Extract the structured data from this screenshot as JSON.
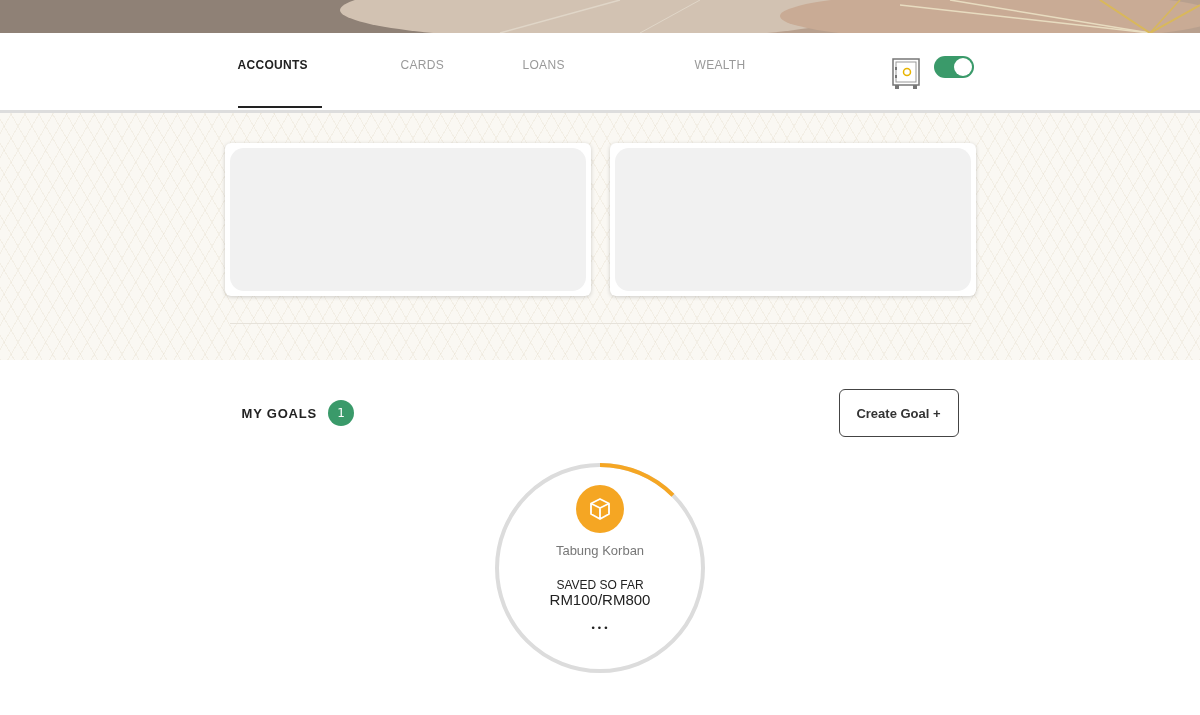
{
  "tabs": [
    {
      "label": "ACCOUNTS",
      "selected": true
    },
    {
      "label": "CARDS",
      "selected": false
    },
    {
      "label": "LOANS",
      "selected": false
    },
    {
      "label": "WEALTH",
      "selected": false
    }
  ],
  "balance_toggle": {
    "on": true
  },
  "account_cards": [
    {
      "kind": "placeholder"
    },
    {
      "kind": "placeholder"
    }
  ],
  "goals": {
    "title": "MY GOALS",
    "count": "1",
    "create_button": "Create Goal +",
    "items": [
      {
        "name": "Tabung Korban",
        "caption": "SAVED SO FAR",
        "amount": "RM100/RM800",
        "level": 0.125,
        "more": "•••"
      }
    ]
  }
}
